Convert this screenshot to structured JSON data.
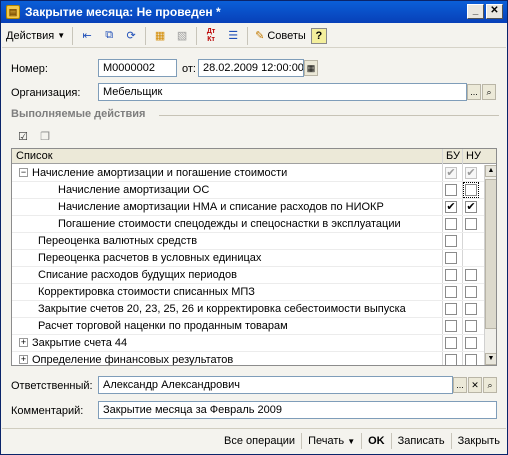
{
  "window": {
    "title": "Закрытие месяца: Не проведен *"
  },
  "toolbar": {
    "actions_label": "Действия",
    "tips_label": "Советы",
    "help_label": "?",
    "dt_kt_label": "Дт Кт"
  },
  "form": {
    "number_label": "Номер:",
    "number_value": "М0000002",
    "date_label": "от:",
    "date_value": "28.02.2009 12:00:00",
    "org_label": "Организация:",
    "org_value": "Мебельщик",
    "section_title": "Выполняемые действия",
    "responsible_label": "Ответственный:",
    "responsible_value": "Александр Александрович",
    "comment_label": "Комментарий:",
    "comment_value": "Закрытие месяца за Февраль 2009"
  },
  "grid": {
    "col_list": "Список",
    "col_bu": "БУ",
    "col_nu": "НУ",
    "rows": [
      {
        "text": "Начисление амортизации и погашение стоимости",
        "bu": "✔",
        "nu": "✔"
      },
      {
        "text": "Начисление амортизации ОС",
        "bu": "",
        "nu": ""
      },
      {
        "text": "Начисление амортизации НМА и списание расходов по НИОКР",
        "bu": "✔",
        "nu": "✔"
      },
      {
        "text": "Погашение стоимости спецодежды и спецоснастки в эксплуатации",
        "bu": "",
        "nu": ""
      },
      {
        "text": "Переоценка валютных средств",
        "bu": "",
        "nu": ""
      },
      {
        "text": "Переоценка расчетов в условных единицах",
        "bu": "",
        "nu": ""
      },
      {
        "text": "Списание расходов будущих периодов",
        "bu": "",
        "nu": ""
      },
      {
        "text": "Корректировка стоимости списанных МПЗ",
        "bu": "",
        "nu": ""
      },
      {
        "text": "Закрытие счетов 20, 23, 25, 26 и корректировка себестоимости выпуска",
        "bu": "",
        "nu": ""
      },
      {
        "text": "Расчет торговой наценки по проданным товарам",
        "bu": "",
        "nu": ""
      },
      {
        "text": "Закрытие счета 44",
        "bu": "",
        "nu": ""
      },
      {
        "text": "Определение финансовых результатов",
        "bu": "",
        "nu": ""
      }
    ]
  },
  "footer": {
    "all_ops": "Все операции",
    "print": "Печать",
    "ok": "OK",
    "save": "Записать",
    "close": "Закрыть"
  }
}
